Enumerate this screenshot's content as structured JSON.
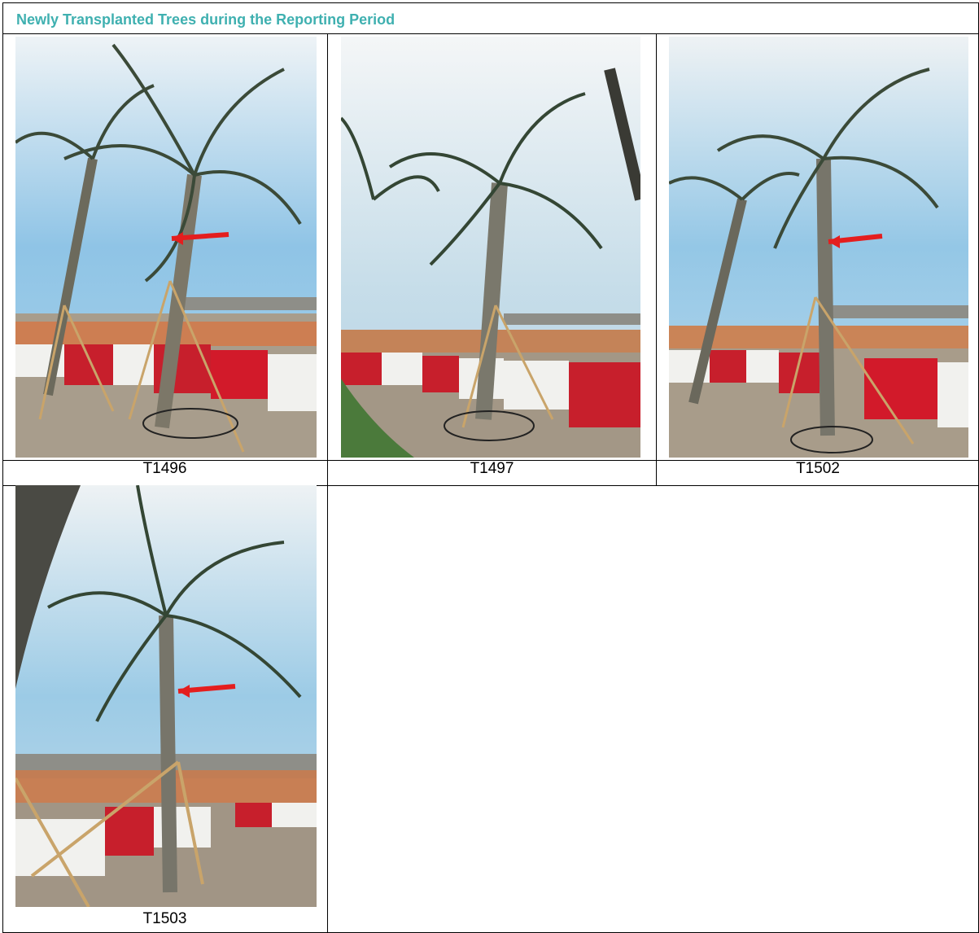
{
  "header": {
    "title": "Newly Transplanted Trees during the Reporting Period"
  },
  "photos": [
    {
      "caption": "T1496"
    },
    {
      "caption": "T1497"
    },
    {
      "caption": "T1502"
    },
    {
      "caption": "T1503"
    }
  ],
  "colors": {
    "title": "#3fb0b0",
    "arrow": "#e41e1e",
    "barrier_red": "#d21a2a"
  }
}
